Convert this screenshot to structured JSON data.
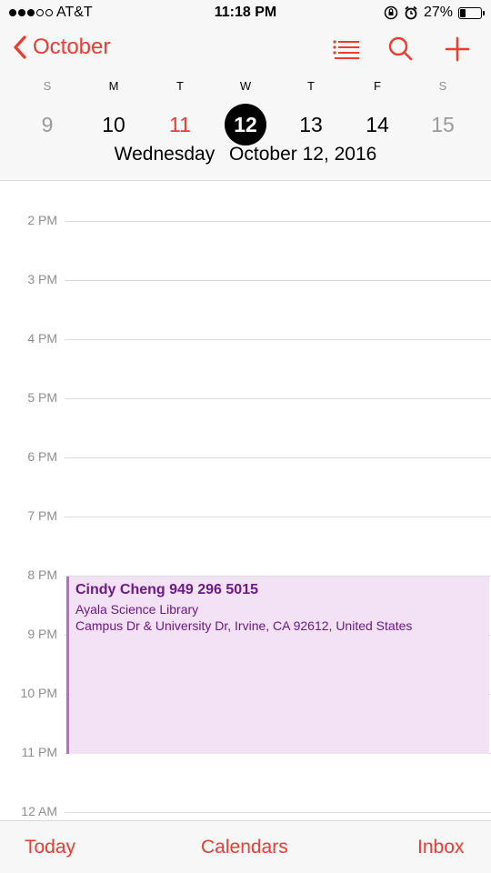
{
  "status_bar": {
    "carrier": "AT&T",
    "time": "11:18 PM",
    "battery_percent": "27%",
    "battery_level": 0.27,
    "icons": [
      "signal-dots-icon",
      "rotation-lock-icon",
      "alarm-icon",
      "battery-icon"
    ]
  },
  "header": {
    "back_label": "October",
    "icons": [
      "list-icon",
      "search-icon",
      "add-icon"
    ],
    "accent_color": "#ef3a2e"
  },
  "week": {
    "days": [
      "S",
      "M",
      "T",
      "W",
      "T",
      "F",
      "S"
    ],
    "dates": [
      "9",
      "10",
      "11",
      "12",
      "13",
      "14",
      "15"
    ],
    "today_index": 2,
    "selected_index": 3
  },
  "full_date": {
    "weekday": "Wednesday",
    "date": "October 12, 2016"
  },
  "timeline": {
    "hours": [
      "2 PM",
      "3 PM",
      "4 PM",
      "5 PM",
      "6 PM",
      "7 PM",
      "8 PM",
      "9 PM",
      "10 PM",
      "11 PM",
      "12 AM"
    ]
  },
  "event": {
    "title": "Cindy Cheng 949 296 5015",
    "location": "Ayala Science Library",
    "address": "Campus Dr & University Dr, Irvine, CA  92612, United States",
    "color": "#b86ad2"
  },
  "tab_bar": {
    "today": "Today",
    "calendars": "Calendars",
    "inbox": "Inbox"
  }
}
